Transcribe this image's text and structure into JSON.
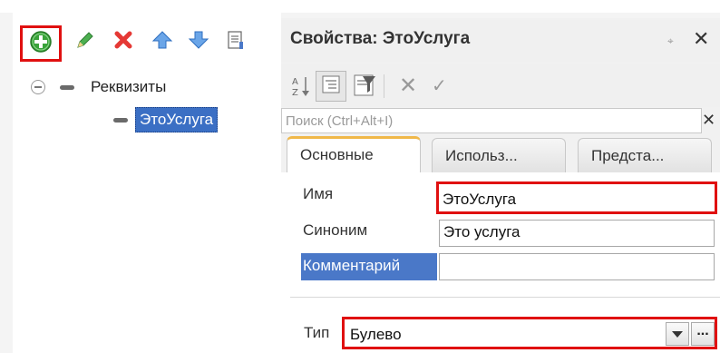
{
  "left_toolbar": {
    "icons": [
      "add-icon",
      "edit-pencil-icon",
      "delete-icon",
      "move-up-icon",
      "move-down-icon",
      "list-icon"
    ]
  },
  "tree": {
    "root_label": "Реквизиты",
    "child_label": "ЭтоУслуга"
  },
  "properties": {
    "title": "Свойства: ЭтоУслуга",
    "pin_glyph": "⌖",
    "close_glyph": "✕",
    "search_placeholder": "Поиск (Ctrl+Alt+I)",
    "search_clear_glyph": "✕",
    "tabs": [
      "Основные",
      "Использ...",
      "Предста..."
    ],
    "fields": {
      "name_label": "Имя",
      "name_value": "ЭтоУслуга",
      "synonym_label": "Синоним",
      "synonym_value": "Это услуга",
      "comment_label": "Комментарий",
      "comment_value": "",
      "type_label": "Тип",
      "type_value": "Булево",
      "type_more_glyph": "..."
    }
  },
  "colors": {
    "highlight_red": "#e01010",
    "selection_blue": "#3b6fc4",
    "comment_label_bg": "#4a78c8",
    "tab_accent": "#f0b84a"
  }
}
